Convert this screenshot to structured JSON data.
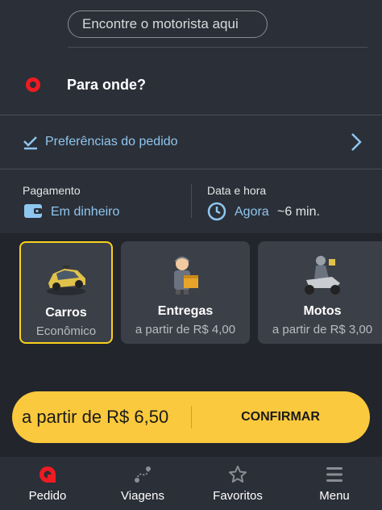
{
  "search": {
    "placeholder": "Encontre o motorista aqui"
  },
  "destination": {
    "label": "Para onde?"
  },
  "preferences": {
    "label": "Preferências do pedido"
  },
  "payment": {
    "label": "Pagamento",
    "value": "Em dinheiro"
  },
  "schedule": {
    "label": "Data e hora",
    "value": "Agora",
    "eta": "~6 min."
  },
  "services": [
    {
      "title": "Carros",
      "subtitle": "Econômico",
      "selected": true
    },
    {
      "title": "Entregas",
      "subtitle": "a partir de R$ 4,00",
      "selected": false
    },
    {
      "title": "Motos",
      "subtitle": "a partir de R$ 3,00",
      "selected": false
    }
  ],
  "confirm": {
    "price": "a partir de R$ 6,50",
    "button": "CONFIRMAR"
  },
  "nav": [
    {
      "label": "Pedido",
      "icon": "order-icon",
      "active": true
    },
    {
      "label": "Viagens",
      "icon": "trips-icon",
      "active": false
    },
    {
      "label": "Favoritos",
      "icon": "star-icon",
      "active": false
    },
    {
      "label": "Menu",
      "icon": "menu-icon",
      "active": false
    }
  ],
  "colors": {
    "accent_yellow": "#fbc93d",
    "brand_red": "#ef1b22",
    "link_blue": "#8fc6f0",
    "background": "#22252c"
  }
}
